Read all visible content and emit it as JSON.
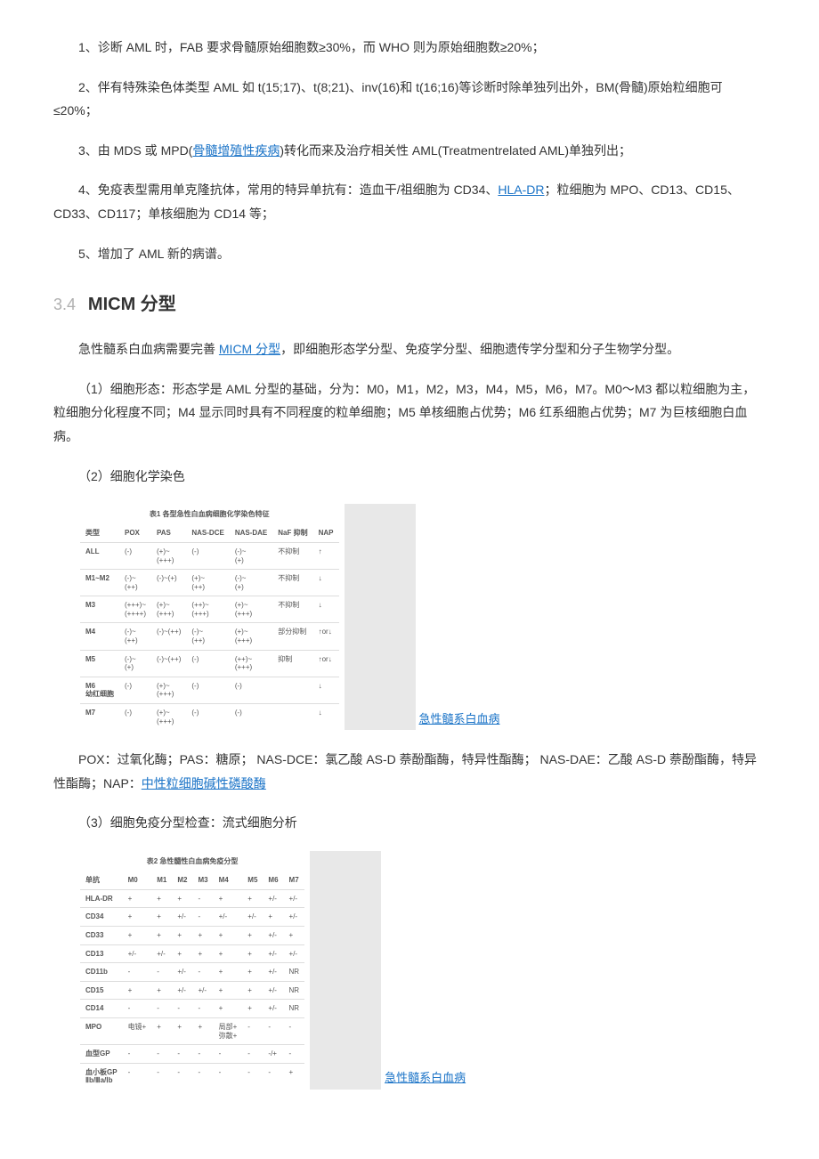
{
  "p1": "1、诊断 AML 时，FAB 要求骨髓原始细胞数≥30%，而 WHO 则为原始细胞数≥20%；",
  "p2a": "2、伴有特殊染色体类型 AML 如 t(15;17)、t(8;21)、inv(16)和 t(16;16)等诊断时除单独列出外，BM(骨髓)原始粒细胞可≤20%；",
  "p3a": "3、由 MDS 或 MPD(",
  "p3_link": "骨髓增殖性疾病",
  "p3b": ")转化而来及治疗相关性 AML(Treatmentrelated AML)单独列出；",
  "p4a": "4、免疫表型需用单克隆抗体，常用的特异单抗有：造血干/祖细胞为 CD34、",
  "p4_link": "HLA-DR",
  "p4b": "；粒细胞为 MPO、CD13、CD15、CD33、CD117；单核细胞为 CD14 等；",
  "p5": "5、增加了 AML 新的病谱。",
  "sec_num": "3.4",
  "sec_title": "MICM 分型",
  "m1a": "急性髓系白血病需要完善 ",
  "m1_link": "MICM 分型",
  "m1b": "，即细胞形态学分型、免疫学分型、细胞遗传学分型和分子生物学分型。",
  "m2": "（1）细胞形态：形态学是 AML 分型的基础，分为：M0，M1，M2，M3，M4，M5，M6，M7。M0～M3 都以粒细胞为主，粒细胞分化程度不同；M4 显示同时具有不同程度的粒单细胞；M5 单核细胞占优势；M6 红系细胞占优势；M7 为巨核细胞白血病。",
  "m3": "（2）细胞化学染色",
  "table1": {
    "title": "表1 各型急性白血病细胞化学染色特征",
    "header": [
      "类型",
      "POX",
      "PAS",
      "NAS-DCE",
      "NAS-DAE",
      "NaF 抑制",
      "NAP"
    ],
    "rows": [
      [
        "ALL",
        "(-)",
        "(+)~\n(+++)",
        "(-)",
        "(-)~\n(+)",
        "不抑制",
        "↑"
      ],
      [
        "M1~M2",
        "(-)~\n(++)",
        "(-)~(+)",
        "(+)~\n(++)",
        "(-)~\n(+)",
        "不抑制",
        "↓"
      ],
      [
        "M3",
        "(+++)~\n(++++)",
        "(+)~\n(+++)",
        "(++)~\n(+++)",
        "(+)~\n(+++)",
        "不抑制",
        "↓"
      ],
      [
        "M4",
        "(-)~\n(++)",
        "(-)~(++)",
        "(-)~\n(++)",
        "(+)~\n(+++)",
        "部分抑制",
        "↑or↓"
      ],
      [
        "M5",
        "(-)~\n(+)",
        "(-)~(++)",
        "(-)",
        "(++)~\n(+++)",
        "抑制",
        "↑or↓"
      ],
      [
        "M6\n幼红细胞",
        "(-)",
        "(+)~\n(+++)",
        "(-)",
        "(-)",
        "",
        "↓"
      ],
      [
        "M7",
        "(-)",
        "(+)~\n(+++)",
        "(-)",
        "(-)",
        "",
        "↓"
      ]
    ],
    "caption": "急性髓系白血病"
  },
  "m4a": "POX：过氧化酶；PAS：糖原； NAS-DCE：氯乙酸 AS-D 萘酚酯酶，特异性酯酶； NAS-DAE：乙酸 AS-D 萘酚酯酶，特异性酯酶；NAP：",
  "m4_link": "中性粒细胞碱性磷酸酶",
  "m5": "（3）细胞免疫分型检查：流式细胞分析",
  "table2": {
    "title": "表2 急性髓性白血病免疫分型",
    "header": [
      "单抗",
      "M0",
      "M1",
      "M2",
      "M3",
      "M4",
      "M5",
      "M6",
      "M7"
    ],
    "rows": [
      [
        "HLA-DR",
        "+",
        "+",
        "+",
        "-",
        "+",
        "+",
        "+/-",
        "+/-"
      ],
      [
        "CD34",
        "+",
        "+",
        "+/-",
        "-",
        "+/-",
        "+/-",
        "+",
        "+/-"
      ],
      [
        "CD33",
        "+",
        "+",
        "+",
        "+",
        "+",
        "+",
        "+/-",
        "+"
      ],
      [
        "CD13",
        "+/-",
        "+/-",
        "+",
        "+",
        "+",
        "+",
        "+/-",
        "+/-"
      ],
      [
        "CD11b",
        "-",
        "-",
        "+/-",
        "-",
        "+",
        "+",
        "+/-",
        "NR"
      ],
      [
        "CD15",
        "+",
        "+",
        "+/-",
        "+/-",
        "+",
        "+",
        "+/-",
        "NR"
      ],
      [
        "CD14",
        "-",
        "-",
        "-",
        "-",
        "+",
        "+",
        "+/-",
        "NR"
      ],
      [
        "MPO",
        "电镜+",
        "+",
        "+",
        "+",
        "局部+\n弥散+",
        "-",
        "-",
        "-"
      ],
      [
        "血型GP",
        "-",
        "-",
        "-",
        "-",
        "-",
        "-",
        "-/+",
        "-"
      ],
      [
        "血小板GP\nⅡb/Ⅲa/Ⅰb",
        "-",
        "-",
        "-",
        "-",
        "-",
        "-",
        "-",
        "+"
      ]
    ],
    "caption": "急性髓系白血病"
  }
}
